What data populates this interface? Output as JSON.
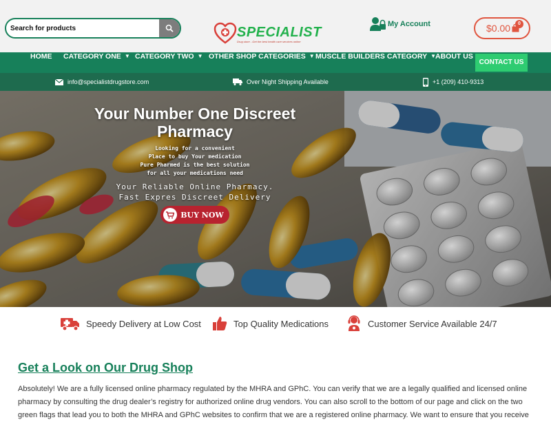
{
  "header": {
    "search": {
      "placeholder": "Search for products",
      "value": ""
    },
    "logo": {
      "name": "SPECIALIST",
      "tagline": "Drug store - Get the best health care services online"
    },
    "account_label": "My Account",
    "cart": {
      "total": "$0.00",
      "count": "0"
    }
  },
  "nav": {
    "items": [
      {
        "label": "HOME",
        "dropdown": false
      },
      {
        "label": "CATEGORY ONE",
        "dropdown": true
      },
      {
        "label": "CATEGORY TWO",
        "dropdown": true
      },
      {
        "label": "OTHER SHOP CATEGORIES",
        "dropdown": true
      },
      {
        "label": "MUSCLE BUILDERS CATEGORY",
        "dropdown": true
      },
      {
        "label": "ABOUT US",
        "dropdown": false
      }
    ],
    "contact_label": "CONTACT US"
  },
  "infobar": {
    "email": "info@specialistdrugstore.com",
    "shipping": "Over Night Shipping Available",
    "phone": "+1 (209) 410-9313"
  },
  "hero": {
    "title_line1": "Your Number One Discreet",
    "title_line2": "Pharmacy",
    "small_lines": [
      "Looking for a convenient",
      "Place to buy Your medication",
      "Pure Pharmed is the best solution",
      "for all your medications need"
    ],
    "tagline_line1": "Your Reliable Online Pharmacy.",
    "tagline_line2": "Fast Expres Discreet Delivery",
    "cta_label": "BUY NOW"
  },
  "features": [
    {
      "icon": "ambulance-icon",
      "label": "Speedy Delivery at Low Cost"
    },
    {
      "icon": "thumbs-up-icon",
      "label": "Top Quality Medications"
    },
    {
      "icon": "support-agent-icon",
      "label": "Customer Service Available 24/7"
    }
  ],
  "section": {
    "title": "Get a Look on Our Drug Shop",
    "body": "Absolutely! We are a fully licensed online pharmacy regulated by the MHRA and GPhC. You can verify that we are a legally qualified and licensed online pharmacy by consulting the drug dealer’s registry for authorized online drug vendors. You can also scroll to the bottom of our page and click on the two green flags that lead you to both the MHRA and GPhC websites to confirm that we are a registered online pharmacy. We want to ensure that you receive"
  },
  "colors": {
    "brand_green": "#17805a",
    "accent_red": "#e0553f",
    "contact_green": "#2ecc71"
  }
}
